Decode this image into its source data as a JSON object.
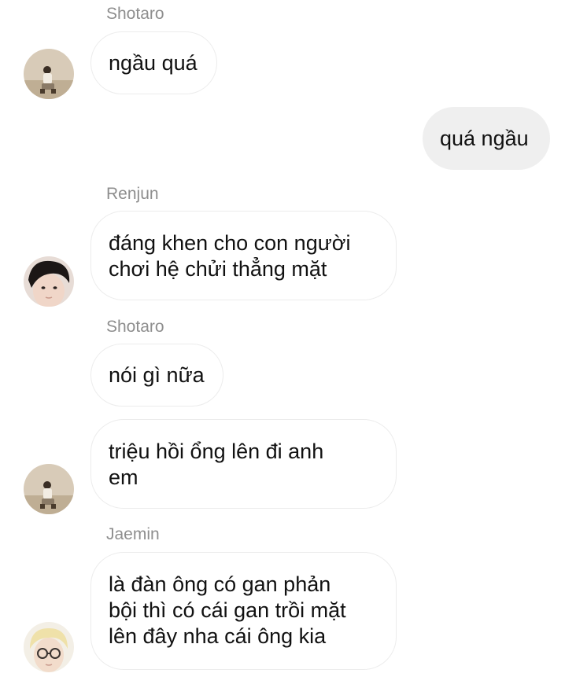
{
  "messages": [
    {
      "sender": "Shotaro",
      "text": "ngầu quá"
    },
    {
      "text": "quá ngầu",
      "outgoing": true
    },
    {
      "sender": "Renjun",
      "text": "đáng khen cho con người\nchơi hệ chửi thẳng mặt"
    },
    {
      "sender": "Shotaro",
      "text": "nói gì nữa"
    },
    {
      "text": "triệu hồi ổng lên đi anh\nem"
    },
    {
      "sender": "Jaemin",
      "text": "là đàn ông có gan phản\nbội thì có cái gan trồi mặt\nlên đây nha cái ông kia"
    }
  ],
  "avatars": {
    "shotaro": "avatar-shotaro",
    "renjun": "avatar-renjun",
    "jaemin": "avatar-jaemin"
  },
  "colors": {
    "sender_label": "#8e8e8e",
    "incoming_border": "#ececec",
    "outgoing_bg": "#efefef",
    "text": "#111111"
  }
}
